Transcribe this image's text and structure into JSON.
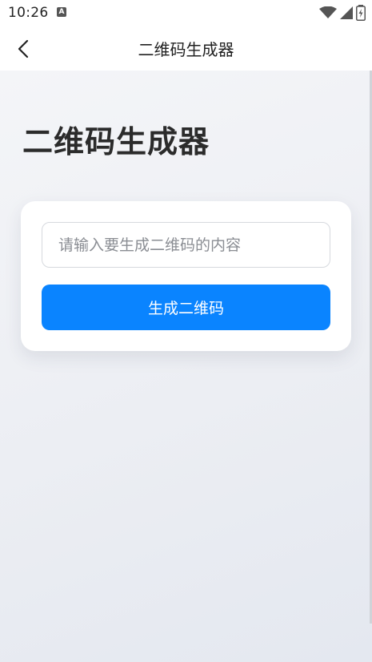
{
  "status_bar": {
    "time": "10:26",
    "notification_icon": "A",
    "icons": [
      "wifi-icon",
      "signal-icon",
      "battery-icon"
    ]
  },
  "app_bar": {
    "back_icon": "chevron-left-icon",
    "title": "二维码生成器"
  },
  "main": {
    "heading": "二维码生成器",
    "input": {
      "placeholder": "请输入要生成二维码的内容",
      "value": ""
    },
    "generate_button": {
      "label": "生成二维码"
    }
  },
  "colors": {
    "accent": "#0a84ff",
    "heading": "#2b2b2b",
    "background": "#eceef3"
  }
}
